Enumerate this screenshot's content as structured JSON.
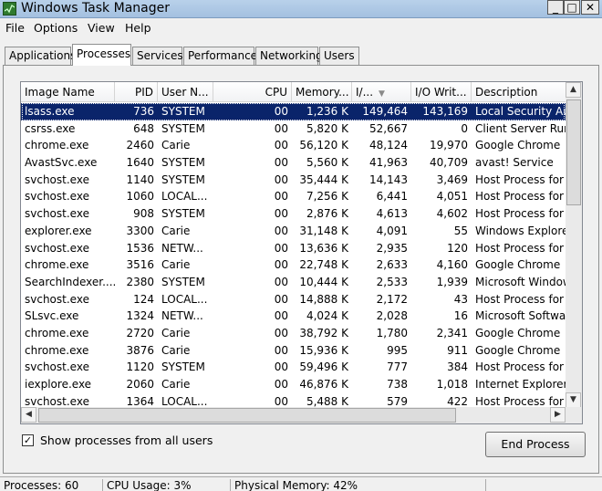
{
  "window": {
    "title": "Windows Task Manager",
    "controls": [
      "_",
      "□",
      "✕"
    ]
  },
  "menu": [
    "File",
    "Options",
    "View",
    "Help"
  ],
  "tabs": [
    {
      "label": "Applications"
    },
    {
      "label": "Processes",
      "active": true
    },
    {
      "label": "Services"
    },
    {
      "label": "Performance"
    },
    {
      "label": "Networking"
    },
    {
      "label": "Users"
    }
  ],
  "columns": [
    "Image Name",
    "PID",
    "User N...",
    "CPU",
    "Memory...",
    "I/...",
    "I/O Writ...",
    "Description"
  ],
  "sorted_column": "I/...",
  "processes": [
    [
      "lsass.exe",
      "736",
      "SYSTEM",
      "00",
      "1,236 K",
      "149,464",
      "143,169",
      "Local Security Auth"
    ],
    [
      "csrss.exe",
      "648",
      "SYSTEM",
      "00",
      "5,820 K",
      "52,667",
      "0",
      "Client Server Runtime"
    ],
    [
      "chrome.exe",
      "2460",
      "Carie",
      "00",
      "56,120 K",
      "48,124",
      "19,970",
      "Google Chrome"
    ],
    [
      "AvastSvc.exe",
      "1640",
      "SYSTEM",
      "00",
      "5,560 K",
      "41,963",
      "40,709",
      "avast! Service"
    ],
    [
      "svchost.exe",
      "1140",
      "SYSTEM",
      "00",
      "35,444 K",
      "14,143",
      "3,469",
      "Host Process for W"
    ],
    [
      "svchost.exe",
      "1060",
      "LOCAL...",
      "00",
      "7,256 K",
      "6,441",
      "4,051",
      "Host Process for W"
    ],
    [
      "svchost.exe",
      "908",
      "SYSTEM",
      "00",
      "2,876 K",
      "4,613",
      "4,602",
      "Host Process for W"
    ],
    [
      "explorer.exe",
      "3300",
      "Carie",
      "00",
      "31,148 K",
      "4,091",
      "55",
      "Windows Explorer"
    ],
    [
      "svchost.exe",
      "1536",
      "NETW...",
      "00",
      "13,636 K",
      "2,935",
      "120",
      "Host Process for W"
    ],
    [
      "chrome.exe",
      "3516",
      "Carie",
      "00",
      "22,748 K",
      "2,633",
      "4,160",
      "Google Chrome"
    ],
    [
      "SearchIndexer....",
      "2380",
      "SYSTEM",
      "00",
      "10,444 K",
      "2,533",
      "1,939",
      "Microsoft Windows"
    ],
    [
      "svchost.exe",
      "124",
      "LOCAL...",
      "00",
      "14,888 K",
      "2,172",
      "43",
      "Host Process for W"
    ],
    [
      "SLsvc.exe",
      "1324",
      "NETW...",
      "00",
      "4,024 K",
      "2,028",
      "16",
      "Microsoft Software"
    ],
    [
      "chrome.exe",
      "2720",
      "Carie",
      "00",
      "38,792 K",
      "1,780",
      "2,341",
      "Google Chrome"
    ],
    [
      "chrome.exe",
      "3876",
      "Carie",
      "00",
      "15,936 K",
      "995",
      "911",
      "Google Chrome"
    ],
    [
      "svchost.exe",
      "1120",
      "SYSTEM",
      "00",
      "59,496 K",
      "777",
      "384",
      "Host Process for W"
    ],
    [
      "iexplore.exe",
      "2060",
      "Carie",
      "00",
      "46,876 K",
      "738",
      "1,018",
      "Internet Explorer"
    ],
    [
      "svchost.exe",
      "1364",
      "LOCAL...",
      "00",
      "5,488 K",
      "579",
      "422",
      "Host Process for W"
    ]
  ],
  "selected_row": 0,
  "show_all_label": "Show processes from all users",
  "show_all_checked": true,
  "end_process_label": "End Process",
  "status": {
    "processes": "Processes: 60",
    "cpu": "CPU Usage: 3%",
    "memory": "Physical Memory: 42%"
  }
}
